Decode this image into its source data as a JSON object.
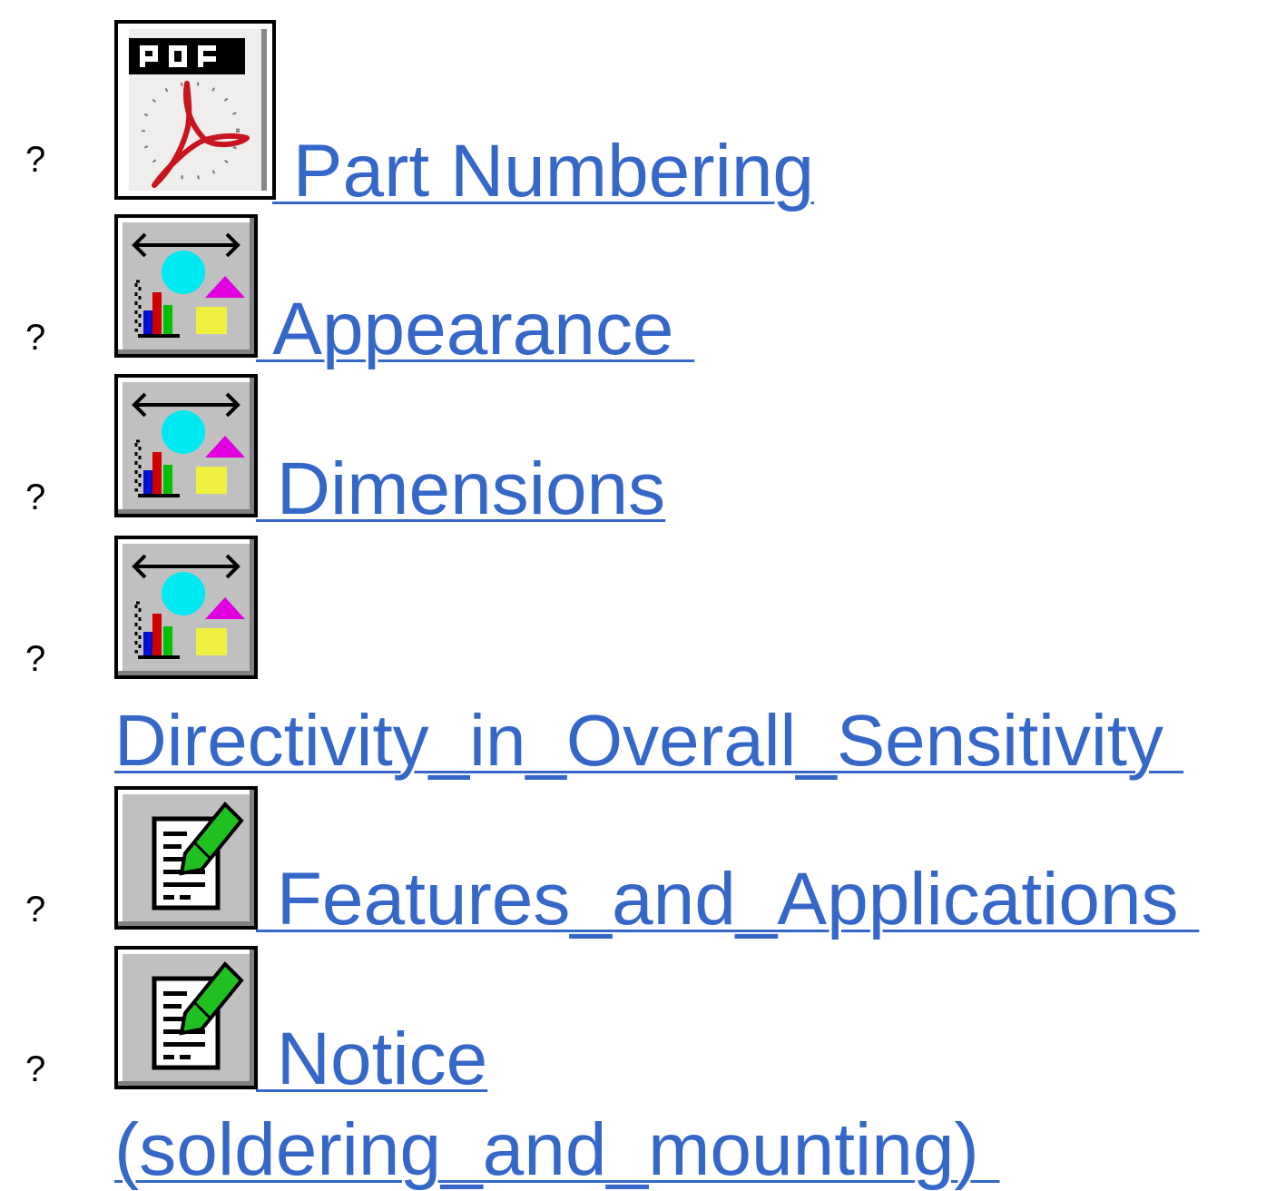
{
  "items": [
    {
      "bullet": "?",
      "icon": "pdf-icon",
      "label": " Part Numbering"
    },
    {
      "bullet": "?",
      "icon": "chart-shapes-icon",
      "label": " Appearance "
    },
    {
      "bullet": "?",
      "icon": "chart-shapes-icon",
      "label": " Dimensions"
    },
    {
      "bullet": "?",
      "icon": "chart-shapes-icon",
      "label": "Directivity_in_Overall_Sensitivity "
    },
    {
      "bullet": "?",
      "icon": "document-pencil-icon",
      "label": " Features_and_Applications "
    },
    {
      "bullet": "?",
      "icon": "document-pencil-icon",
      "label_line1": " Notice",
      "label_line2": "(soldering_and_mounting) "
    }
  ],
  "colors": {
    "link": "#3567c8",
    "bullet": "#000000"
  }
}
